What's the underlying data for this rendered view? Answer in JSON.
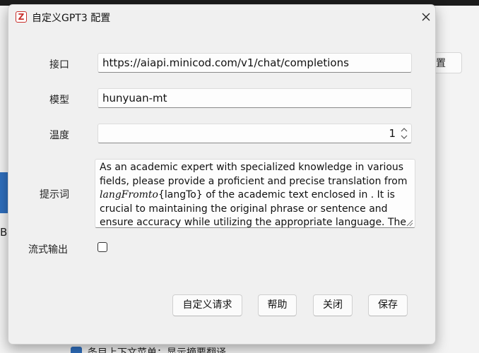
{
  "background": {
    "button_label": "置",
    "partial_letter": "B",
    "footer_text": "条目上下文菜单：显示摘要翻译"
  },
  "dialog": {
    "title": "自定义GPT3 配置",
    "app_icon_glyph": "Z",
    "close_icon": "close-icon"
  },
  "form": {
    "endpoint": {
      "label": "接口",
      "value": "https://aiapi.minicod.com/v1/chat/completions"
    },
    "model": {
      "label": "模型",
      "value": "hunyuan-mt"
    },
    "temperature": {
      "label": "温度",
      "value": "1"
    },
    "prompt": {
      "label": "提示词",
      "lines": [
        {
          "text": "As an academic expert with specialized knowledge in various"
        },
        {
          "text": "fields, please provide a proficient and precise translation from"
        },
        {
          "italic": "langFromto",
          "text": "{langTo} of the academic text enclosed in . It is"
        },
        {
          "text": "crucial to maintaining the original phrase or sentence and"
        },
        {
          "text": "ensure accuracy while utilizing the appropriate language. The"
        }
      ]
    },
    "stream": {
      "label": "流式输出",
      "checked": false
    }
  },
  "buttons": {
    "custom_request": "自定义请求",
    "help": "帮助",
    "close": "关闭",
    "save": "保存"
  },
  "colors": {
    "accent_blue": "#2f6fbd",
    "dialog_bg": "#f0f0f0",
    "app_icon_red": "#c9302c"
  }
}
